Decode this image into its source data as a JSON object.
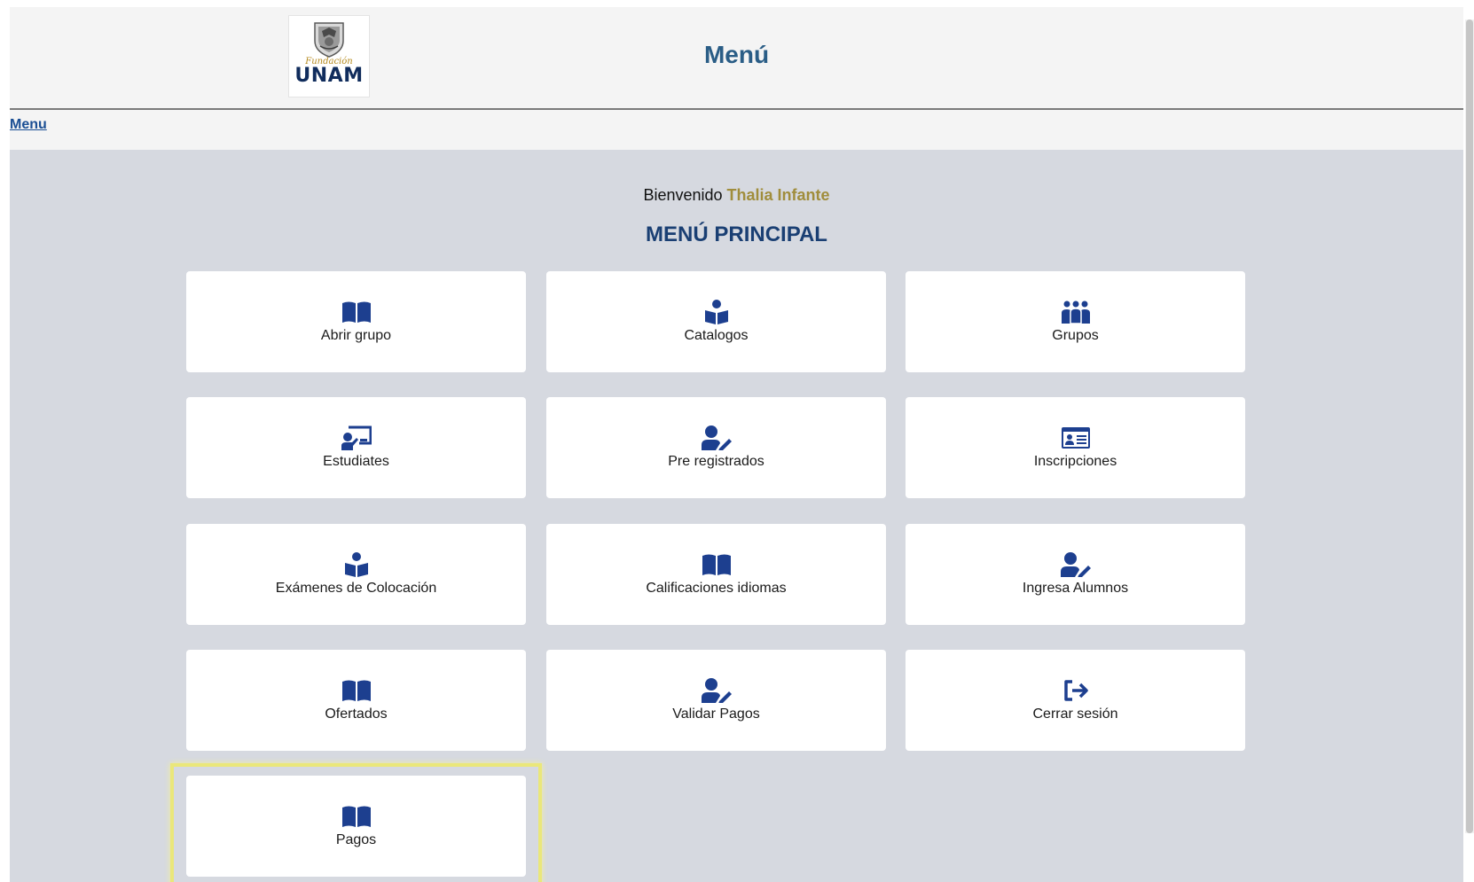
{
  "header": {
    "title": "Menú",
    "logo": {
      "small_text": "Fundación",
      "big_text": "UNAM"
    }
  },
  "breadcrumb": {
    "link": "Menu"
  },
  "welcome": {
    "prefix": "Bienvenido",
    "user": "Thalia Infante"
  },
  "main_title": "MENÚ PRINCIPAL",
  "tiles": [
    {
      "label": "Abrir grupo",
      "icon": "book-open-icon"
    },
    {
      "label": "Catalogos",
      "icon": "book-reader-icon"
    },
    {
      "label": "Grupos",
      "icon": "users-icon"
    },
    {
      "label": "Estudiates",
      "icon": "chalkboard-teacher-icon"
    },
    {
      "label": "Pre registrados",
      "icon": "user-edit-icon"
    },
    {
      "label": "Inscripciones",
      "icon": "id-card-icon"
    },
    {
      "label": "Exámenes de Colocación",
      "icon": "book-reader-icon"
    },
    {
      "label": "Calificaciones idiomas",
      "icon": "book-open-icon"
    },
    {
      "label": "Ingresa Alumnos",
      "icon": "user-edit-icon"
    },
    {
      "label": "Ofertados",
      "icon": "book-open-icon"
    },
    {
      "label": "Validar Pagos",
      "icon": "user-edit-icon"
    },
    {
      "label": "Cerrar sesión",
      "icon": "sign-out-icon"
    },
    {
      "label": "Pagos",
      "icon": "book-open-icon"
    }
  ],
  "colors": {
    "icon": "#1d3f8f",
    "header_title": "#2a5d86",
    "main_title": "#1a3f73",
    "user_name": "#a08d3c",
    "highlight": "#eae77a",
    "background": "#d6d9e0"
  }
}
